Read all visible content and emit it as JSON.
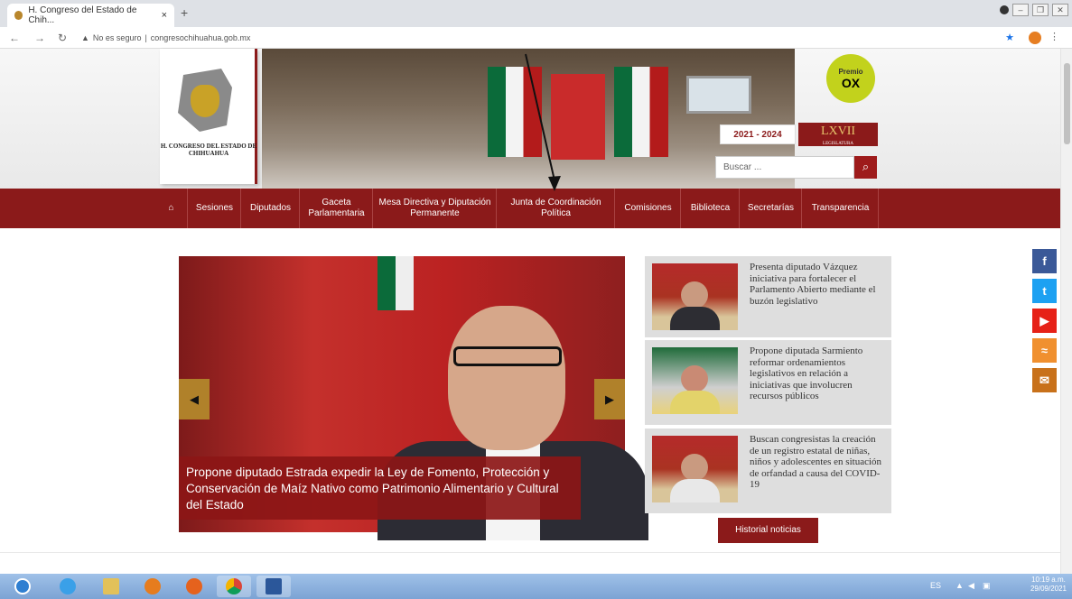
{
  "browser": {
    "tab_title": "H. Congreso del Estado de Chih...",
    "tab_close": "×",
    "new_tab": "+",
    "security": "No es seguro",
    "url": "congresochihuahua.gob.mx"
  },
  "header": {
    "logo_text": "H. CONGRESO DEL ESTADO DE CHIHUAHUA",
    "premio_label": "Premio",
    "premio_name": "OX",
    "years": "2021 - 2024",
    "legislature": "LXVII",
    "legislature_sub": "LEGISLATURA",
    "search_placeholder": "Buscar ..."
  },
  "nav": {
    "home_icon": "home-icon",
    "items": [
      {
        "label": "Sesiones"
      },
      {
        "label": "Diputados"
      },
      {
        "label": "Gaceta Parlamentaria"
      },
      {
        "label": "Mesa Directiva y Diputación Permanente"
      },
      {
        "label": "Junta de Coordinación Política"
      },
      {
        "label": "Comisiones"
      },
      {
        "label": "Biblioteca"
      },
      {
        "label": "Secretarías"
      },
      {
        "label": "Transparencia"
      }
    ]
  },
  "slider": {
    "caption": "Propone diputado Estrada expedir la Ley de Fomento, Protección y Conservación de Maíz Nativo como Patrimonio Alimentario y Cultural del Estado",
    "prev": "◀",
    "next": "▶"
  },
  "news": [
    {
      "title": "Presenta diputado Vázquez iniciativa para fortalecer el Parlamento Abierto mediante el buzón legislativo"
    },
    {
      "title": "Propone diputada Sarmiento reformar ordenamientos legislativos en relación a iniciativas que involucren recursos públicos"
    },
    {
      "title": "Buscan congresistas la creación de un registro estatal de niñas, niños y adolescentes en situación de orfandad a causa del COVID-19"
    }
  ],
  "history_button": "Historial noticias",
  "social": [
    {
      "name": "facebook-icon",
      "glyph": "f",
      "color": "#3b5998"
    },
    {
      "name": "twitter-icon",
      "glyph": "t",
      "color": "#1da1f2"
    },
    {
      "name": "youtube-icon",
      "glyph": "▶",
      "color": "#e62117"
    },
    {
      "name": "rss-icon",
      "glyph": "≈",
      "color": "#f0902f"
    },
    {
      "name": "mail-icon",
      "glyph": "✉",
      "color": "#c8711a"
    }
  ],
  "taskbar": {
    "lang": "ES",
    "time": "10:19 a.m.",
    "date": "29/09/2021"
  },
  "colors": {
    "brand": "#8b1a1a",
    "accent": "#b0812a"
  }
}
